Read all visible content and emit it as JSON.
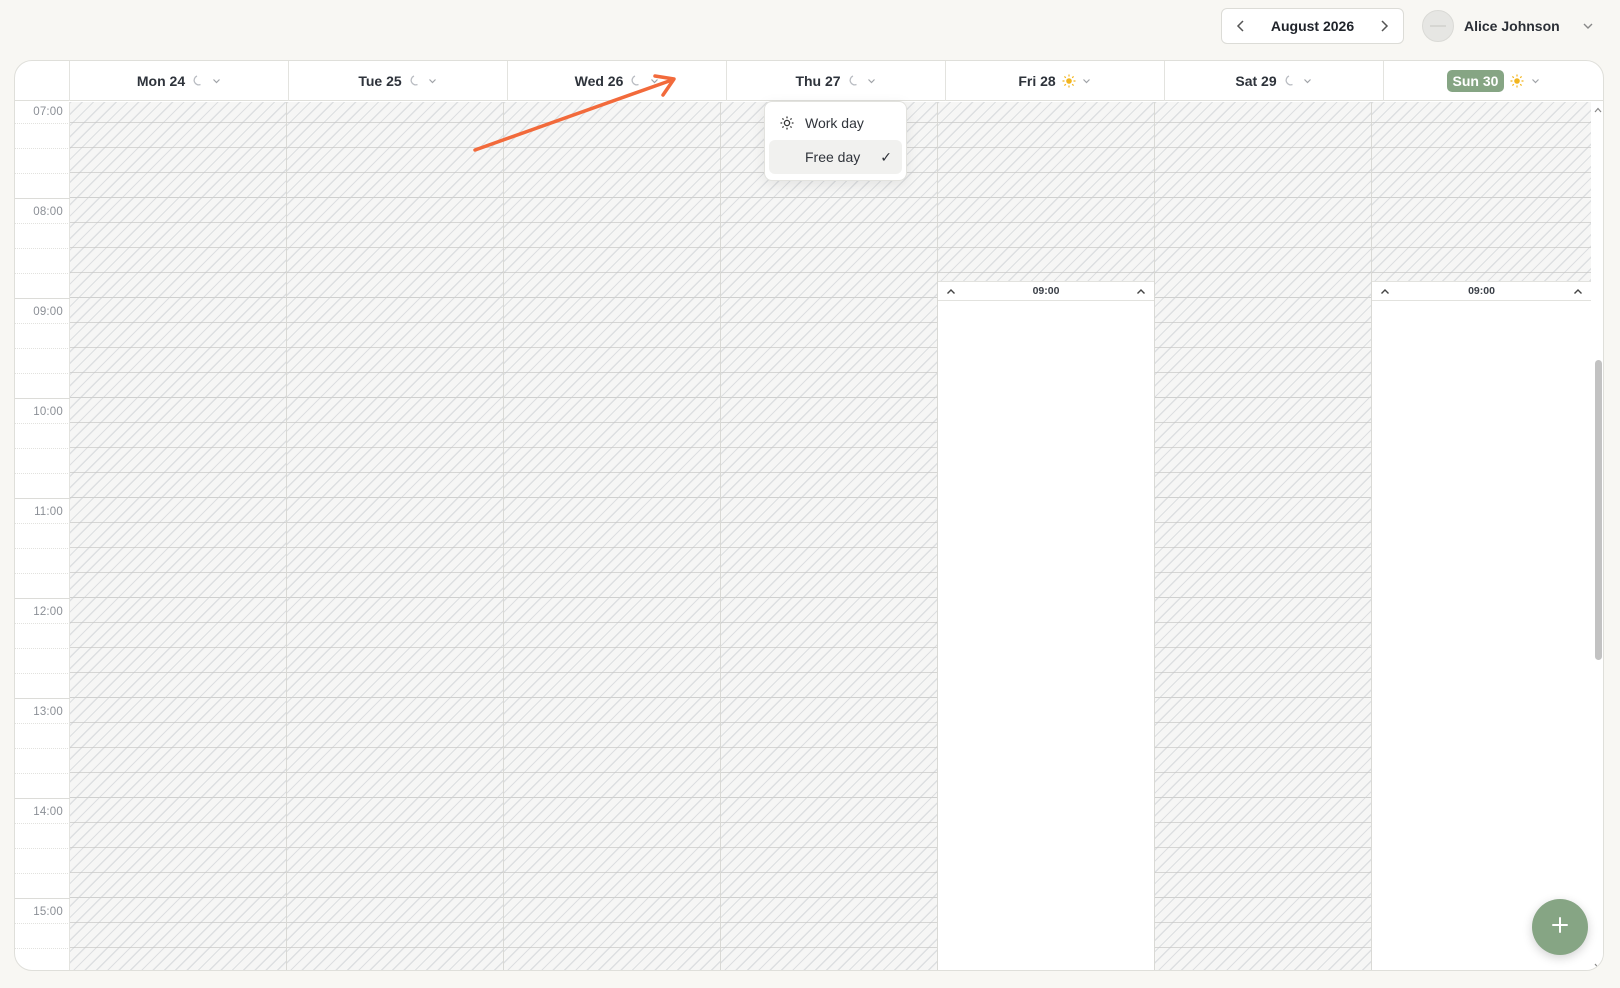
{
  "top_bar": {
    "month_label": "August 2026",
    "prev_icon": "chevron-left-icon",
    "next_icon": "chevron-right-icon",
    "user_name": "Alice Johnson"
  },
  "calendar": {
    "days": [
      {
        "label": "Mon 24",
        "mode": "free",
        "today": false
      },
      {
        "label": "Tue 25",
        "mode": "free",
        "today": false
      },
      {
        "label": "Wed 26",
        "mode": "free",
        "today": false
      },
      {
        "label": "Thu 27",
        "mode": "free",
        "today": false
      },
      {
        "label": "Fri 28",
        "mode": "work",
        "today": false,
        "start_time": "09:00"
      },
      {
        "label": "Sat 29",
        "mode": "free",
        "today": false
      },
      {
        "label": "Sun 30",
        "mode": "work",
        "today": true,
        "start_time": "09:00"
      }
    ],
    "times": [
      "07:00",
      "08:00",
      "09:00",
      "10:00",
      "11:00",
      "12:00",
      "13:00",
      "14:00",
      "15:00"
    ]
  },
  "day_menu": {
    "items": [
      {
        "label": "Work day",
        "icon": "sun-icon",
        "selected": false
      },
      {
        "label": "Free day",
        "icon": "moon-icon",
        "selected": true
      }
    ],
    "check_glyph": "✓"
  },
  "colors": {
    "accent": "#86a584",
    "annotation_arrow": "#f26a3b",
    "sun": "#f2b51f",
    "moon": "#b9bcc2"
  }
}
